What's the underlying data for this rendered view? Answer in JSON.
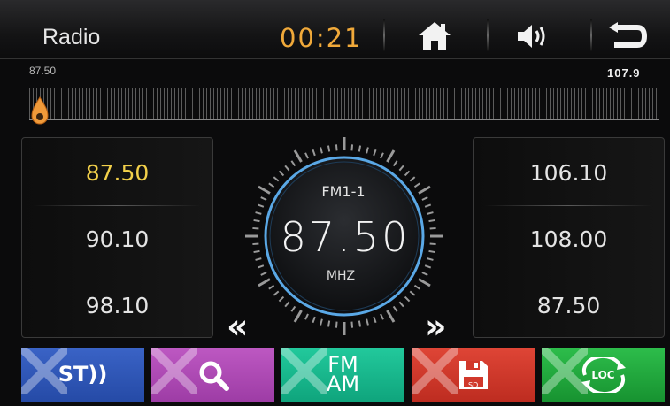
{
  "header": {
    "app_title": "Radio",
    "clock": "00:21",
    "icons": [
      "home-icon",
      "volume-icon",
      "back-icon"
    ]
  },
  "scale": {
    "min_label": "87.50",
    "max_label": "107.9",
    "tuned_fraction": 0.0
  },
  "presets_left": [
    "87.50",
    "90.10",
    "98.10"
  ],
  "presets_right": [
    "106.10",
    "108.00",
    "87.50"
  ],
  "active_preset_index": 0,
  "dial": {
    "band": "FM1-1",
    "frequency": "87.50",
    "unit": "MHZ"
  },
  "seek": {
    "prev": "«",
    "next": "»"
  },
  "buttons": {
    "st": "ST))",
    "fm_am": [
      "FM",
      "AM"
    ],
    "sd": "SD",
    "loc": "LOC"
  },
  "colors": {
    "clock": "#f0a93a",
    "active_preset": "#f2d04a",
    "st_button": "#2f57b8",
    "search_button": "#b04ab6",
    "fmam_button": "#16b98c",
    "save_button": "#d1382b",
    "loc_button": "#1ea83a"
  }
}
